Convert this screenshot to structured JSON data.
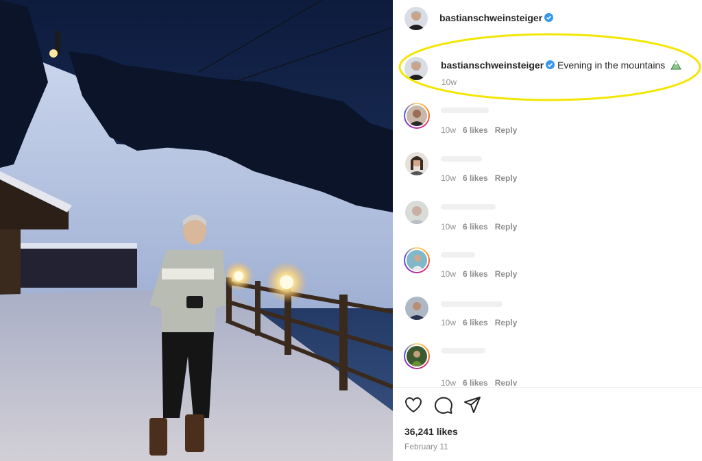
{
  "post": {
    "author": "bastianschweinsteiger",
    "verified": true,
    "caption_author": "bastianschweinsteiger",
    "caption_text": "Evening in the mountains",
    "caption_emoji": "mountain-emoji",
    "caption_time": "10w"
  },
  "comments": [
    {
      "time": "10w",
      "likes": "6 likes",
      "reply": "Reply",
      "avatar_ring": true
    },
    {
      "time": "10w",
      "likes": "6 likes",
      "reply": "Reply",
      "avatar_ring": false
    },
    {
      "time": "10w",
      "likes": "6 likes",
      "reply": "Reply",
      "avatar_ring": false
    },
    {
      "time": "10w",
      "likes": "6 likes",
      "reply": "Reply",
      "avatar_ring": true
    },
    {
      "time": "10w",
      "likes": "6 likes",
      "reply": "Reply",
      "avatar_ring": false
    },
    {
      "time": "10w",
      "likes": "6 likes",
      "reply": "Reply",
      "avatar_ring": true
    }
  ],
  "actions": {
    "like_icon": "heart-icon",
    "comment_icon": "comment-icon",
    "share_icon": "send-icon"
  },
  "stats": {
    "likes_total": "36,241 likes",
    "date": "February 11"
  },
  "colors": {
    "verified_blue": "#3897f0",
    "highlight_yellow": "#f3e600",
    "meta_gray": "#8e8e8e",
    "text_dark": "#262626"
  }
}
